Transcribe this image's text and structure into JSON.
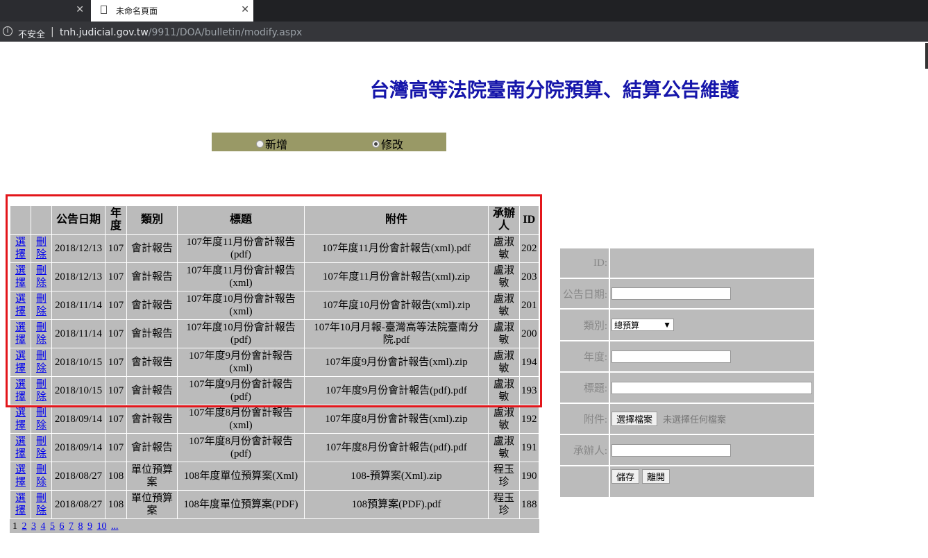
{
  "browser": {
    "tabs": [
      {
        "title": "",
        "close": "✕"
      },
      {
        "title": "未命名頁面",
        "close": "✕"
      }
    ],
    "address": {
      "security": "不安全",
      "separator": "|",
      "host": "tnh.judicial.gov.tw",
      "path": "/9911/DOA/bulletin/modify.aspx"
    }
  },
  "page": {
    "title": "台灣高等法院臺南分院預算、結算公告維護",
    "mode": {
      "options": [
        {
          "label": "新增",
          "selected": false
        },
        {
          "label": "修改",
          "selected": true
        }
      ]
    }
  },
  "grid": {
    "headers": [
      "",
      "",
      "公告日期",
      "年度",
      "類別",
      "標題",
      "附件",
      "承辦人",
      "ID"
    ],
    "select_label": "選擇",
    "delete_label": "刪除",
    "rows": [
      {
        "date": "2018/12/13",
        "year": "107",
        "category": "會計報告",
        "title": "107年度11月份會計報告(pdf)",
        "attachment": "107年度11月份會計報告(xml).pdf",
        "handler": "盧淑敏",
        "id": "202"
      },
      {
        "date": "2018/12/13",
        "year": "107",
        "category": "會計報告",
        "title": "107年度11月份會計報告(xml)",
        "attachment": "107年度11月份會計報告(xml).zip",
        "handler": "盧淑敏",
        "id": "203"
      },
      {
        "date": "2018/11/14",
        "year": "107",
        "category": "會計報告",
        "title": "107年度10月份會計報告(xml)",
        "attachment": "107年度10月份會計報告(xml).zip",
        "handler": "盧淑敏",
        "id": "201"
      },
      {
        "date": "2018/11/14",
        "year": "107",
        "category": "會計報告",
        "title": "107年度10月份會計報告(pdf)",
        "attachment": "107年10月月報-臺灣高等法院臺南分院.pdf",
        "handler": "盧淑敏",
        "id": "200"
      },
      {
        "date": "2018/10/15",
        "year": "107",
        "category": "會計報告",
        "title": "107年度9月份會計報告(xml)",
        "attachment": "107年度9月份會計報告(xml).zip",
        "handler": "盧淑敏",
        "id": "194"
      },
      {
        "date": "2018/10/15",
        "year": "107",
        "category": "會計報告",
        "title": "107年度9月份會計報告(pdf)",
        "attachment": "107年度9月份會計報告(pdf).pdf",
        "handler": "盧淑敏",
        "id": "193"
      },
      {
        "date": "2018/09/14",
        "year": "107",
        "category": "會計報告",
        "title": "107年度8月份會計報告(xml)",
        "attachment": "107年度8月份會計報告(xml).zip",
        "handler": "盧淑敏",
        "id": "192"
      },
      {
        "date": "2018/09/14",
        "year": "107",
        "category": "會計報告",
        "title": "107年度8月份會計報告(pdf)",
        "attachment": "107年度8月份會計報告(pdf).pdf",
        "handler": "盧淑敏",
        "id": "191"
      },
      {
        "date": "2018/08/27",
        "year": "108",
        "category": "單位預算案",
        "title": "108年度單位預算案(Xml)",
        "attachment": "108-預算案(Xml).zip",
        "handler": "程玉珍",
        "id": "190"
      },
      {
        "date": "2018/08/27",
        "year": "108",
        "category": "單位預算案",
        "title": "108年度單位預算案(PDF)",
        "attachment": "108預算案(PDF).pdf",
        "handler": "程玉珍",
        "id": "188"
      }
    ],
    "pager": {
      "current": "1",
      "links": [
        "2",
        "3",
        "4",
        "5",
        "6",
        "7",
        "8",
        "9",
        "10",
        "..."
      ]
    }
  },
  "form": {
    "id_label": "ID:",
    "date_label": "公告日期:",
    "category_label": "類別:",
    "category_value": "總預算",
    "year_label": "年度:",
    "title_label": "標題:",
    "attachment_label": "附件:",
    "file_button": "選擇檔案",
    "no_file": "未選擇任何檔案",
    "handler_label": "承辦人:",
    "save_button": "儲存",
    "leave_button": "離開"
  },
  "colors": {
    "heading": "#1515aa",
    "mode_bar": "#999966",
    "grid_bg": "#bbbbbb",
    "highlight": "#e3161b"
  }
}
